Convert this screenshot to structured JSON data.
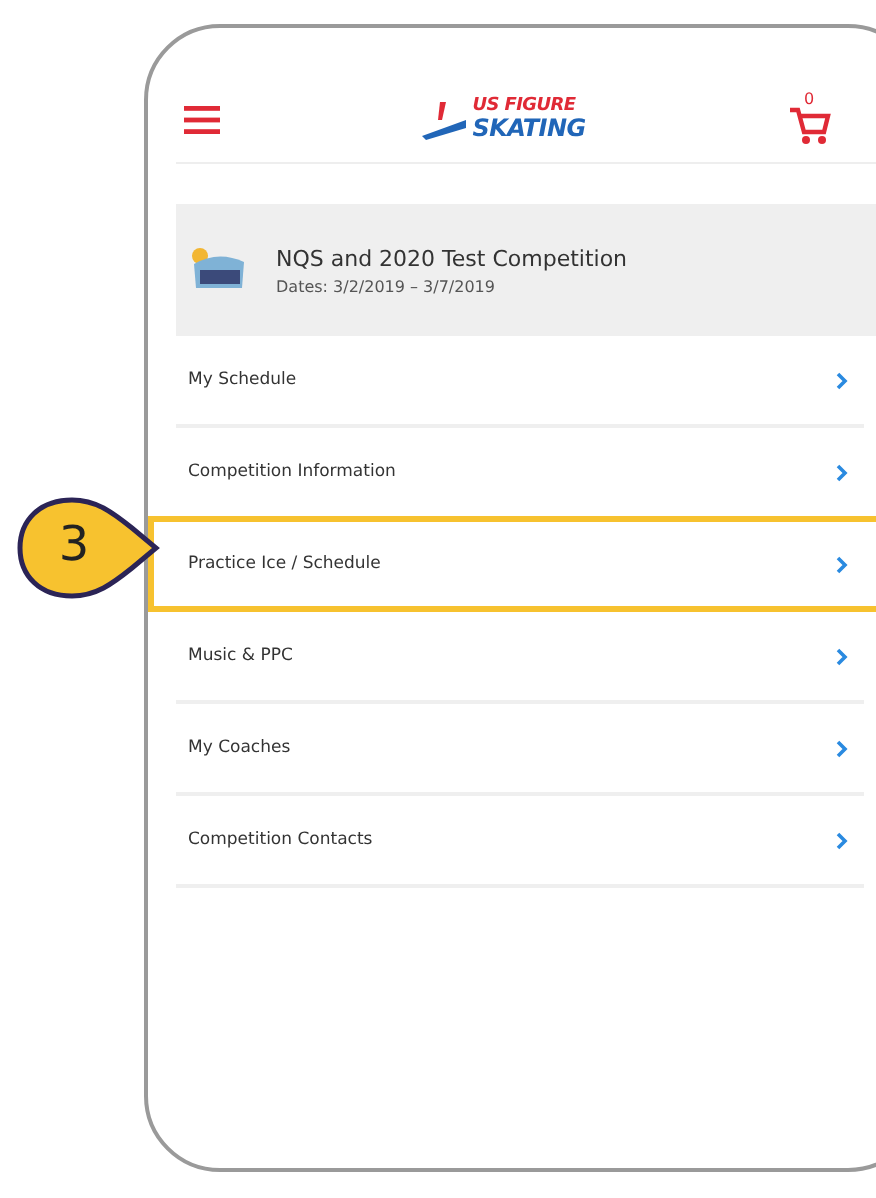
{
  "header": {
    "logo_top": "US FIGURE",
    "logo_bottom": "SKATING",
    "cart_count": "0"
  },
  "event": {
    "title": "NQS and 2020 Test Competition",
    "dates": "Dates: 3/2/2019 – 3/7/2019"
  },
  "menu": [
    {
      "label": "My Schedule",
      "highlighted": false
    },
    {
      "label": "Competition Information",
      "highlighted": false
    },
    {
      "label": "Practice Ice / Schedule",
      "highlighted": true
    },
    {
      "label": "Music & PPC",
      "highlighted": false
    },
    {
      "label": "My Coaches",
      "highlighted": false
    },
    {
      "label": "Competition Contacts",
      "highlighted": false
    }
  ],
  "callout": {
    "label": "3"
  }
}
